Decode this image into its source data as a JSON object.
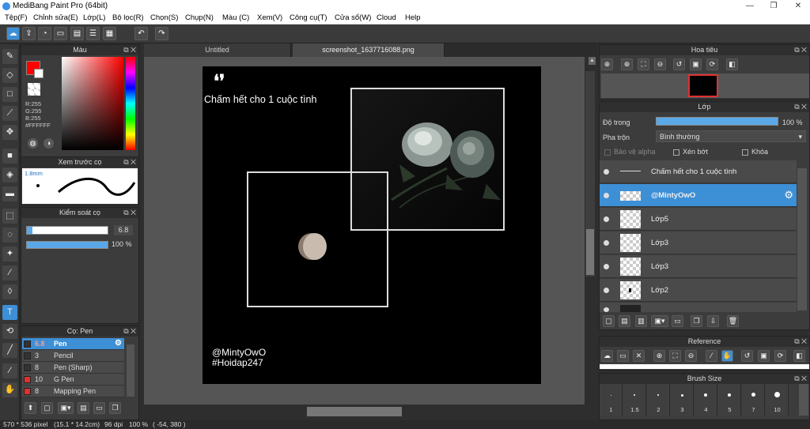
{
  "window": {
    "title": "MediBang Paint Pro (64bit)",
    "minimize": "—",
    "restore": "❐",
    "close": "✕"
  },
  "menu": [
    "Tệp(F)",
    "Chỉnh sửa(E)",
    "Lớp(L)",
    "Bộ lọc(R)",
    "Chọn(S)",
    "Chụp(N)",
    "Màu (C)",
    "Xem(V)",
    "Công cụ(T)",
    "Cửa sổ(W)",
    "Cloud",
    "Help"
  ],
  "color_panel": {
    "title": "Màu",
    "r": "R:255",
    "g": "G:255",
    "b": "B:255",
    "hex": "#FFFFFF",
    "fg_color": "#ff0000",
    "bg_color": "#ffffff"
  },
  "brush_preview": {
    "title": "Xem trước cọ",
    "size": "1.8mm"
  },
  "brush_control": {
    "title": "Kiểm soát cọ",
    "size_value": "6.8",
    "opacity_value": "100 %",
    "size_fraction": 0.07,
    "opacity_fraction": 1.0
  },
  "brush_list": {
    "title": "Cọ: Pen",
    "items": [
      {
        "size": "6.8",
        "name": "Pen",
        "color": "#ffffff"
      },
      {
        "size": "3",
        "name": "Pencil",
        "color": "#333333"
      },
      {
        "size": "8",
        "name": "Pen (Sharp)",
        "color": "#333333"
      },
      {
        "size": "10",
        "name": "G Pen",
        "color": "#e03030"
      },
      {
        "size": "8",
        "name": "Mapping Pen",
        "color": "#e03030"
      }
    ]
  },
  "tabs": [
    "Untitled",
    "screenshot_1637716088.png"
  ],
  "canvas": {
    "quote_mark": "❛❜",
    "heading": "Chấm hết cho 1 cuộc tình",
    "handle": "@MintyOwO",
    "hashtag": "#Hoidap247",
    "bg_color": "#000000"
  },
  "navigator": {
    "title": "Hoa tiêu"
  },
  "layer_panel": {
    "title": "Lớp",
    "opacity_label": "Độ trong",
    "opacity_value": "100 %",
    "opacity_fraction": 1.0,
    "blend_label": "Pha trộn",
    "blend_value": "Bình thường",
    "protect_alpha": "Bảo vệ alpha",
    "clipping": "Xén bớt",
    "lock": "Khóa",
    "layers": [
      {
        "name": "Chấm hết cho 1 cuộc tình",
        "selected": false
      },
      {
        "name": "@MintyOwO",
        "selected": true
      },
      {
        "name": "Lớp5",
        "selected": false
      },
      {
        "name": "Lớp3",
        "selected": false
      },
      {
        "name": "Lớp3",
        "selected": false
      },
      {
        "name": "Lớp2",
        "selected": false
      }
    ]
  },
  "reference": {
    "title": "Reference"
  },
  "brush_size": {
    "title": "Brush Size",
    "sizes": [
      "1",
      "1.5",
      "2",
      "3",
      "4",
      "5",
      "7",
      "10"
    ]
  },
  "status": {
    "dimensions": "570 * 536 pixel",
    "physical": "(15.1 * 14.2cm)",
    "dpi": "96 dpi",
    "zoom": "100 %",
    "coords": "( -54, 380 )"
  }
}
